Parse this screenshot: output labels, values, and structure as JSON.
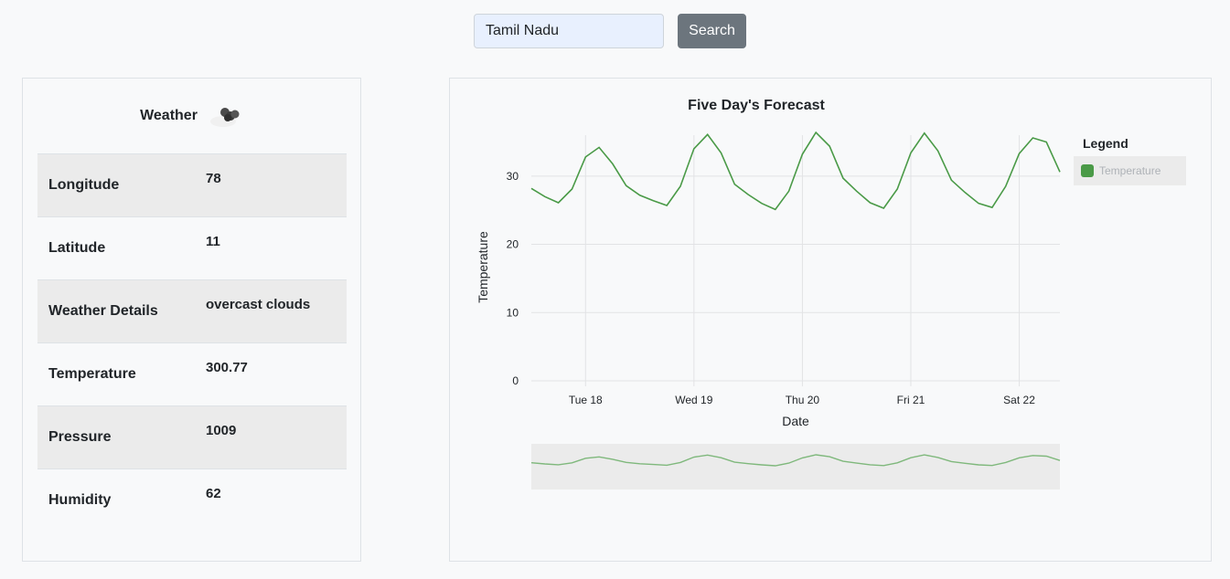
{
  "search": {
    "value": "Tamil Nadu",
    "button_label": "Search"
  },
  "weather": {
    "title": "Weather",
    "icon": "cloud-icon",
    "rows": [
      {
        "label": "Longitude",
        "value": "78"
      },
      {
        "label": "Latitude",
        "value": "11"
      },
      {
        "label": "Weather Details",
        "value": "overcast clouds"
      },
      {
        "label": "Temperature",
        "value": "300.77"
      },
      {
        "label": "Pressure",
        "value": "1009"
      },
      {
        "label": "Humidity",
        "value": "62"
      }
    ]
  },
  "colors": {
    "series": "#4a9a47",
    "grid": "#e2e3e5",
    "navigator_bg": "#ebebeb"
  },
  "chart_data": {
    "type": "line",
    "title": "Five Day's Forecast",
    "xlabel": "Date",
    "ylabel": "Temperature",
    "ylim": [
      0,
      36
    ],
    "yticks": [
      0,
      10,
      20,
      30
    ],
    "grid": true,
    "legend": {
      "title": "Legend",
      "position": "top-right"
    },
    "x_ticks": [
      "Tue 18",
      "Wed 19",
      "Thu 20",
      "Fri 21",
      "Sat 22"
    ],
    "x_start": "Mon 17 12:00",
    "x_interval_hours": 3,
    "series": [
      {
        "name": "Temperature",
        "values": [
          28.2,
          27.0,
          26.1,
          28.1,
          32.8,
          34.2,
          31.8,
          28.6,
          27.2,
          26.4,
          25.7,
          28.5,
          34.0,
          36.1,
          33.4,
          28.8,
          27.3,
          26.0,
          25.1,
          27.8,
          33.2,
          36.4,
          34.4,
          29.7,
          27.8,
          26.1,
          25.3,
          28.1,
          33.4,
          36.3,
          33.7,
          29.4,
          27.6,
          26.0,
          25.4,
          28.5,
          33.3,
          35.6,
          35.0,
          30.6
        ]
      }
    ]
  }
}
